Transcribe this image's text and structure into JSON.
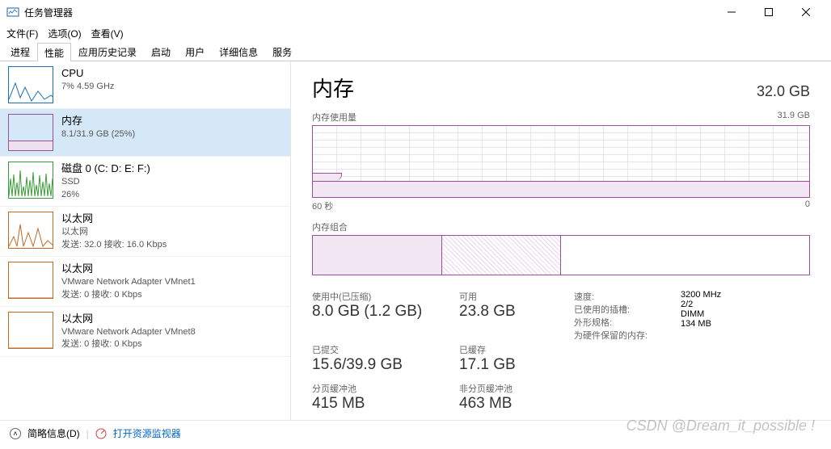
{
  "window": {
    "title": "任务管理器"
  },
  "menu": {
    "file": "文件(F)",
    "options": "选项(O)",
    "view": "查看(V)"
  },
  "tabs": [
    "进程",
    "性能",
    "应用历史记录",
    "启动",
    "用户",
    "详细信息",
    "服务"
  ],
  "sidebar": [
    {
      "title": "CPU",
      "sub1": "7% 4.59 GHz",
      "color": "#1a6fb5"
    },
    {
      "title": "内存",
      "sub1": "8.1/31.9 GB (25%)",
      "color": "#9b4f9b",
      "selected": true
    },
    {
      "title": "磁盘 0 (C: D: E: F:)",
      "sub1": "SSD",
      "sub2": "26%",
      "color": "#3b9b3b"
    },
    {
      "title": "以太网",
      "sub1": "以太网",
      "sub2": "发送: 32.0 接收: 16.0 Kbps",
      "color": "#c16a26"
    },
    {
      "title": "以太网",
      "sub1": "VMware Network Adapter VMnet1",
      "sub2": "发送: 0 接收: 0 Kbps",
      "color": "#c16a26"
    },
    {
      "title": "以太网",
      "sub1": "VMware Network Adapter VMnet8",
      "sub2": "发送: 0 接收: 0 Kbps",
      "color": "#c16a26"
    }
  ],
  "main": {
    "title": "内存",
    "capacity": "32.0 GB",
    "usage_label": "内存使用量",
    "usage_max": "31.9 GB",
    "axis_left": "60 秒",
    "axis_right": "0",
    "comp_label": "内存组合",
    "stats": {
      "inuse_label": "使用中(已压缩)",
      "inuse_val": "8.0 GB (1.2 GB)",
      "avail_label": "可用",
      "avail_val": "23.8 GB",
      "commit_label": "已提交",
      "commit_val": "15.6/39.9 GB",
      "cached_label": "已缓存",
      "cached_val": "17.1 GB",
      "paged_label": "分页缓冲池",
      "paged_val": "415 MB",
      "nonpaged_label": "非分页缓冲池",
      "nonpaged_val": "463 MB"
    },
    "specs": {
      "speed_label": "速度:",
      "speed_val": "3200 MHz",
      "slots_label": "已使用的插槽:",
      "slots_val": "2/2",
      "form_label": "外形规格:",
      "form_val": "DIMM",
      "reserved_label": "为硬件保留的内存:",
      "reserved_val": "134 MB"
    }
  },
  "footer": {
    "less": "简略信息(D)",
    "resmon": "打开资源监视器"
  },
  "watermark": "CSDN @Dream_it_possible !",
  "chart_data": {
    "type": "area",
    "title": "内存使用量",
    "ylabel": "GB",
    "ylim": [
      0,
      31.9
    ],
    "xlabel": "秒",
    "xlim": [
      60,
      0
    ],
    "series": [
      {
        "name": "使用中",
        "values": [
          9.5,
          9.5,
          9.4,
          8.6,
          8.2,
          8.1,
          8.1,
          8.1,
          8.1,
          8.1,
          8.1,
          8.1,
          8.1,
          8.1,
          8.1,
          8.1,
          8.1,
          8.1,
          8.1,
          8.1
        ]
      }
    ]
  }
}
